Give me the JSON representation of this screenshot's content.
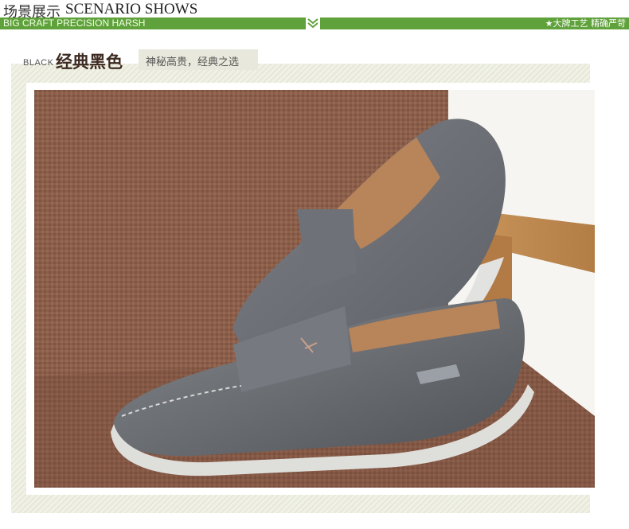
{
  "header": {
    "title_cn": "场景展示",
    "title_en": "SCENARIO SHOWS"
  },
  "banner": {
    "left_text": "BIG CRAFT PRECISION HARSH",
    "right_text": "★大牌工艺 精确严苛",
    "chevron_icon": "double-chevron-down-icon",
    "color": "#5fa13a"
  },
  "section": {
    "label_en": "BLACK",
    "title": "经典黑色",
    "subtitle": "神秘高贵，经典之选"
  },
  "photo": {
    "subject": "grey-leather-loafers-on-chair"
  },
  "colors": {
    "accent_green": "#5fa13a",
    "title_brown": "#3d2a20",
    "shoe_grey": "#6a6d72",
    "chair_brown": "#8b5f4a"
  }
}
